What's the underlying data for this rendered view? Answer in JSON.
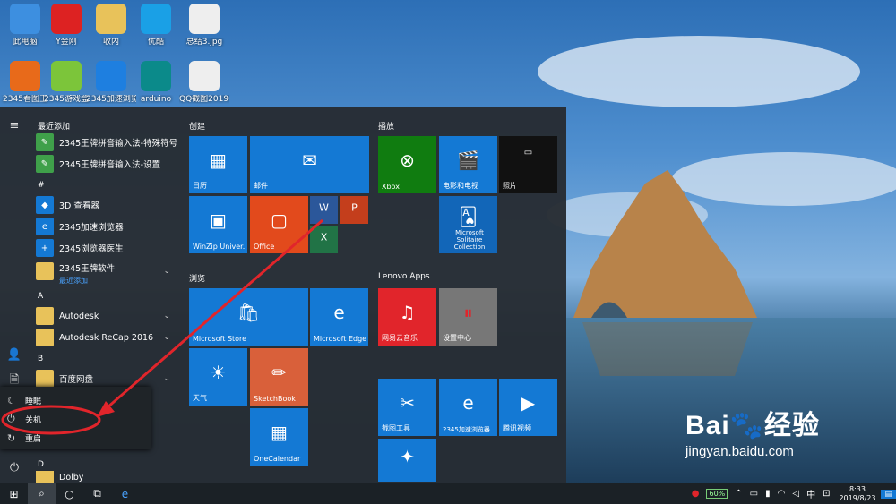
{
  "desktop": {
    "icons": [
      {
        "label": "此电脑",
        "icon": "computer-icon",
        "color": "#3d8fe0"
      },
      {
        "label": "Y金刚",
        "icon": "app-icon",
        "color": "#d22"
      },
      {
        "label": "收内",
        "icon": "folder-icon",
        "color": "#e8c25a"
      },
      {
        "label": "优酷",
        "icon": "play-icon",
        "color": "#1aa0e6"
      },
      {
        "label": "总结3.jpg",
        "icon": "image-icon",
        "color": "#eee"
      },
      {
        "label": "2345看图王",
        "icon": "picture-icon",
        "color": "#e86a1a"
      },
      {
        "label": "2345游戏盒",
        "icon": "game-icon",
        "color": "#7cc53a"
      },
      {
        "label": "2345加速浏览器",
        "icon": "browser-icon",
        "color": "#1e7fe0"
      },
      {
        "label": "arduino",
        "icon": "arduino-icon",
        "color": "#0b8a8a"
      },
      {
        "label": "QQ截图20190823...",
        "icon": "image-icon",
        "color": "#eee"
      }
    ]
  },
  "start_menu": {
    "rail": {
      "hamburger": "≡",
      "user": "👤",
      "documents": "🗎",
      "power": "⏻"
    },
    "recent_header": "最近添加",
    "recent": [
      {
        "label": "2345王牌拼音输入法-特殊符号"
      },
      {
        "label": "2345王牌拼音输入法-设置"
      }
    ],
    "section_hash": "#",
    "hash_apps": [
      {
        "label": "3D 查看器",
        "sub": ""
      },
      {
        "label": "2345加速浏览器",
        "sub": ""
      },
      {
        "label": "2345浏览器医生",
        "sub": ""
      },
      {
        "label": "2345王牌软件",
        "sub": "最近添加"
      }
    ],
    "section_a": "A",
    "a_apps": [
      {
        "label": "Autodesk"
      },
      {
        "label": "Autodesk ReCap 2016"
      }
    ],
    "section_b": "B",
    "b_apps": [
      {
        "label": "百度网盘"
      }
    ],
    "section_d": "D",
    "d_apps": [
      {
        "label": "Dolby"
      }
    ],
    "power_menu": {
      "sleep": "睡眠",
      "shutdown": "关机",
      "restart": "重启"
    },
    "groups": {
      "create": "创建",
      "play": "播放",
      "browse": "浏览",
      "lenovo": "Lenovo Apps"
    },
    "tiles": {
      "calendar": "日历",
      "mail": "邮件",
      "winzip": "WinZip Univer...",
      "office": "Office",
      "xbox": "Xbox",
      "movies": "电影和电视",
      "photos": "照片",
      "solitaire": "Microsoft Solitaire Collection",
      "store": "Microsoft Store",
      "edge": "Microsoft Edge",
      "weather": "天气",
      "sketchbook": "SketchBook",
      "onecalendar": "OneCalendar",
      "netease": "网易云音乐",
      "settings": "设置中心",
      "snip": "截图工具",
      "b2345": "2345加速浏览器",
      "tencent": "腾讯视频"
    }
  },
  "taskbar": {
    "battery": "60%",
    "ime": "中",
    "clock_time": "8:33",
    "clock_date": "2019/8/23"
  },
  "watermark": {
    "brand": "Bai🐾经验",
    "url": "jingyan.baidu.com"
  },
  "colors": {
    "accent": "#1479d4",
    "highlight": "#e1252b",
    "menu_bg": "#262c32"
  }
}
